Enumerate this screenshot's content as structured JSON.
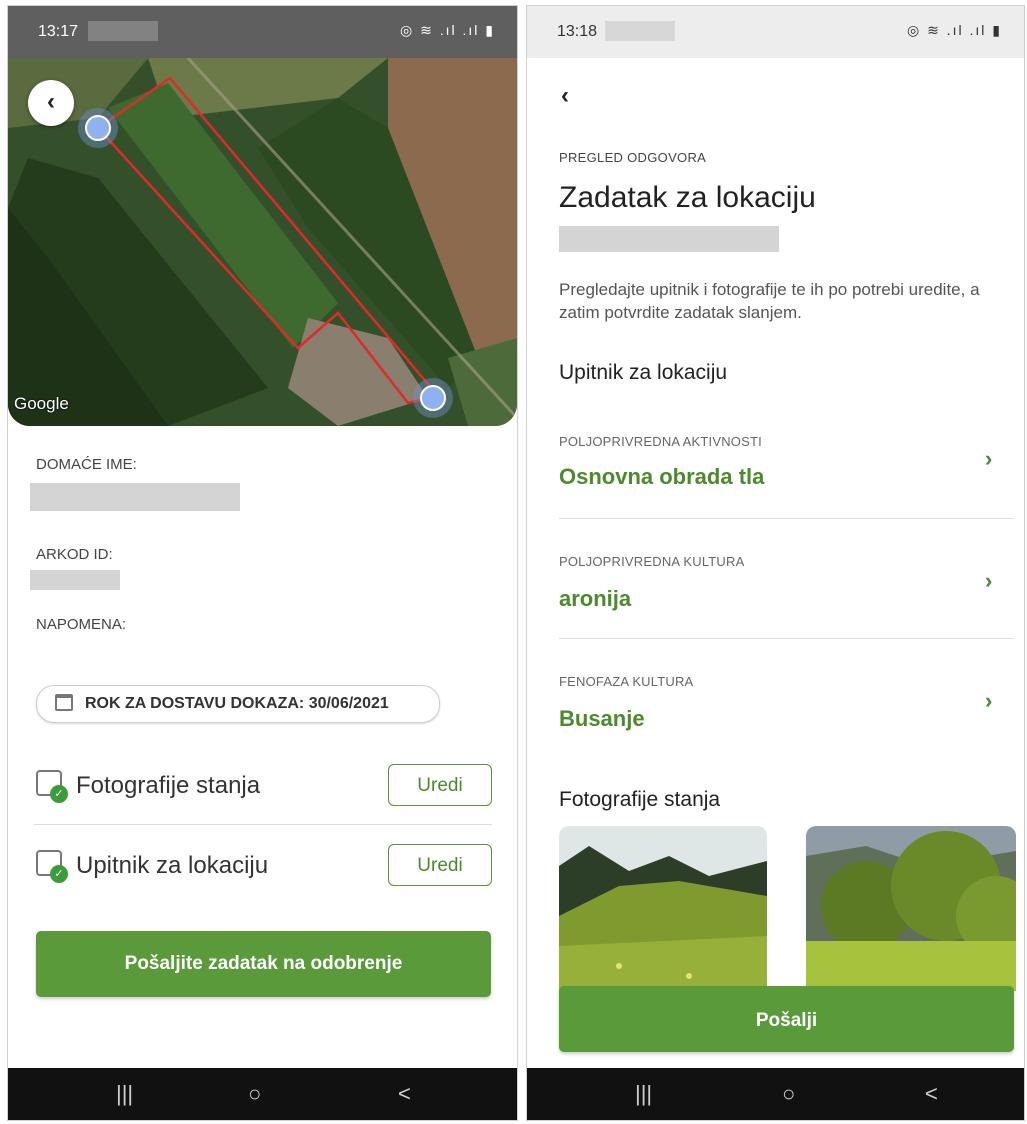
{
  "left": {
    "status_time": "13:17",
    "status_icons": "◎ ≋ .ıl .ıl ▮",
    "map_provider": "Google",
    "back_icon": "chevron-left-icon",
    "fields": {
      "domace_ime_label": "DOMAĆE IME:",
      "arkod_id_label": "ARKOD ID:",
      "napomena_label": "NAPOMENA:"
    },
    "deadline_text": "ROK ZA DOSTAVU DOKAZA: 30/06/2021",
    "items": [
      {
        "label": "Fotografije stanja",
        "button": "Uredi",
        "icon": "photo-check-icon"
      },
      {
        "label": "Upitnik za lokaciju",
        "button": "Uredi",
        "icon": "clipboard-check-icon"
      }
    ],
    "submit_button": "Pošaljite zadatak na odobrenje",
    "nav": {
      "recent": "|||",
      "home": "○",
      "back": "<"
    }
  },
  "right": {
    "status_time": "13:18",
    "status_icons": "◎ ≋ .ıl .ıl ▮",
    "back_icon": "chevron-left-icon",
    "overline": "PREGLED ODGOVORA",
    "title": "Zadatak za lokaciju",
    "description": "Pregledajte upitnik i fotografije te ih po potrebi uredite, a zatim potvrdite zadatak slanjem.",
    "questionnaire_title": "Upitnik za lokaciju",
    "questions": [
      {
        "label": "POLJOPRIVREDNA AKTIVNOSTI",
        "value": "Osnovna obrada tla"
      },
      {
        "label": "POLJOPRIVREDNA KULTURA",
        "value": "aronija"
      },
      {
        "label": "FENOFAZA KULTURA",
        "value": "Busanje"
      }
    ],
    "photos_title": "Fotografije stanja",
    "submit_button": "Pošalji",
    "nav": {
      "recent": "|||",
      "home": "○",
      "back": "<"
    }
  },
  "colors": {
    "accent": "#5b9a3a",
    "accent_text": "#4c8a2e"
  }
}
